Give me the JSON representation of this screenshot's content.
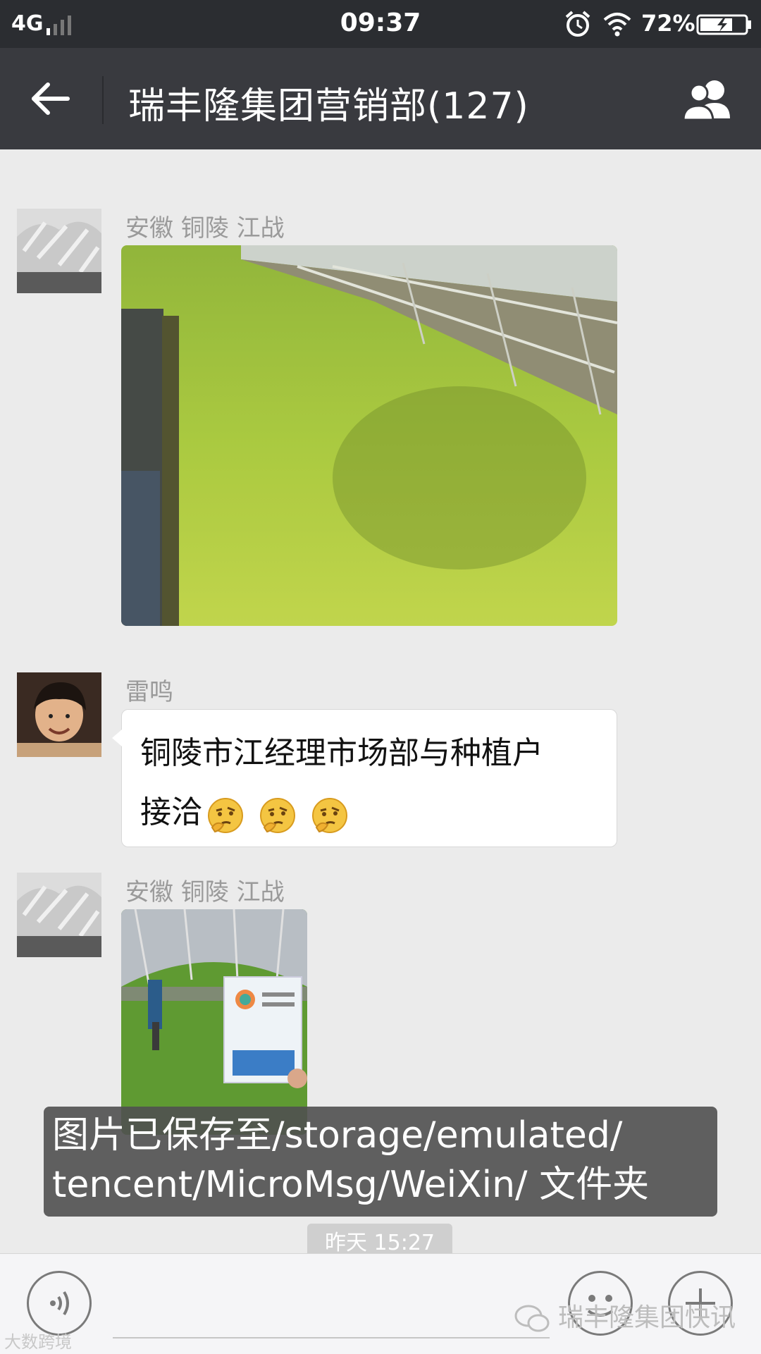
{
  "status_bar": {
    "network": "4G",
    "time": "09:37",
    "battery_text": "72%",
    "battery_level": 0.72
  },
  "header": {
    "title": "瑞丰隆集团营销部(127)"
  },
  "messages": [
    {
      "sender": "安徽 铜陵  江战",
      "type": "image"
    },
    {
      "sender": "雷鸣",
      "type": "text",
      "text_line1": "铜陵市江经理市场部与种植户",
      "text_line2": "接洽"
    },
    {
      "sender": "安徽 铜陵  江战",
      "type": "image"
    }
  ],
  "toast": {
    "line1": "图片已保存至/storage/emulated/",
    "line2": "tencent/MicroMsg/WeiXin/ 文件夹"
  },
  "timestamp": "昨天 15:27",
  "watermark": "瑞丰隆集团快讯",
  "watermark_bottom_left": "大数跨境",
  "icons": {
    "back": "arrow-left",
    "members": "group-people",
    "voice": "voice-waves",
    "emoji": "smiley-face",
    "plus": "plus",
    "emoji_in_text": "thinking-face"
  },
  "colors": {
    "status_bar": "#2b2d31",
    "title_bar": "#393a3f",
    "chat_bg": "#ebebeb",
    "bubble": "#ffffff",
    "toast_bg": "#505050"
  }
}
